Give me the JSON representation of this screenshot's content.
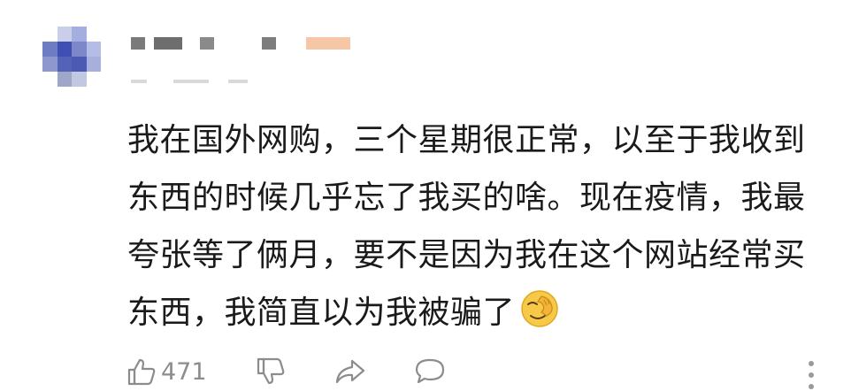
{
  "comment": {
    "lines": [
      "我在国外网购，三个星期很正常，以至于我收到",
      "东西的时候几乎忘了我买的啥。现在疫情，我最",
      "夸张等了俩月，要不是因为我在这个网站经常买",
      "东西，我简直以为我被骗了"
    ],
    "emoji": "facepalm-emoji"
  },
  "actions": {
    "like_count": "471"
  },
  "colors": {
    "text": "#1a1a1a",
    "muted": "#8c8c8c",
    "highlight_tag": "#f6c7a6"
  }
}
